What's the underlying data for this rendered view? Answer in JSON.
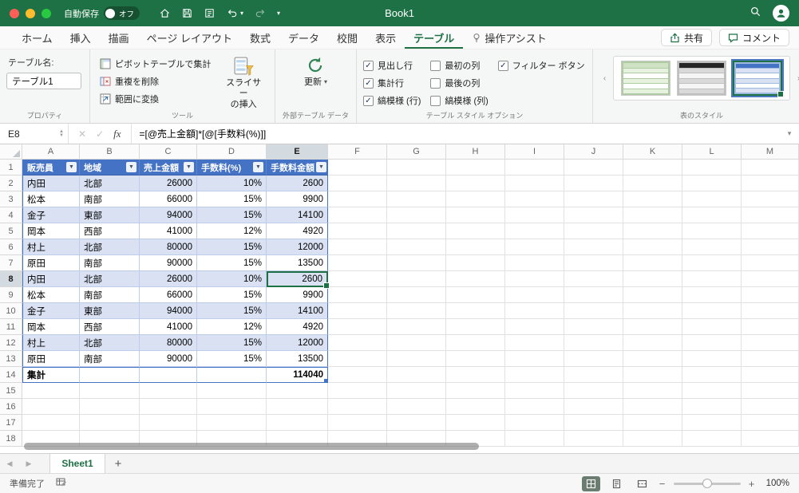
{
  "colors": {
    "titlebar_green": "#1E7145",
    "accent_green": "#217346",
    "table_header_blue": "#4472C4",
    "band_blue": "#D9E1F2"
  },
  "title_bar": {
    "autosave_label": "自動保存",
    "autosave_state": "オフ",
    "title": "Book1"
  },
  "menu_tabs": {
    "items": [
      {
        "label": "ホーム",
        "active": false
      },
      {
        "label": "挿入",
        "active": false
      },
      {
        "label": "描画",
        "active": false
      },
      {
        "label": "ページ レイアウト",
        "active": false
      },
      {
        "label": "数式",
        "active": false
      },
      {
        "label": "データ",
        "active": false
      },
      {
        "label": "校閲",
        "active": false
      },
      {
        "label": "表示",
        "active": false
      },
      {
        "label": "テーブル",
        "active": true
      },
      {
        "label": "操作アシスト",
        "active": false,
        "icon": "lightbulb"
      }
    ],
    "share_label": "共有",
    "comments_label": "コメント"
  },
  "ribbon": {
    "table_name": {
      "label": "テーブル名:",
      "value": "テーブル1",
      "group": "プロパティ"
    },
    "tools": {
      "buttons": [
        "ピボットテーブルで集計",
        "重複を削除",
        "範囲に変換"
      ],
      "slicer_line1": "スライサー",
      "slicer_line2": "の挿入",
      "group": "ツール"
    },
    "external": {
      "refresh_label": "更新",
      "group": "外部テーブル データ"
    },
    "options": {
      "checkboxes": [
        {
          "label": "見出し行",
          "checked": true
        },
        {
          "label": "集計行",
          "checked": true
        },
        {
          "label": "縞模様 (行)",
          "checked": true
        },
        {
          "label": "最初の列",
          "checked": false
        },
        {
          "label": "最後の列",
          "checked": false
        },
        {
          "label": "縞模様 (列)",
          "checked": false
        },
        {
          "label": "フィルター ボタン",
          "checked": true
        }
      ],
      "group": "テーブル スタイル オプション"
    },
    "styles": {
      "swatches": [
        "table-style-light-green",
        "table-style-dark",
        "table-style-blue"
      ],
      "selected_index": 2,
      "group": "表のスタイル"
    }
  },
  "formula_bar": {
    "name_box": "E8",
    "fx": "fx",
    "formula": "=[@売上金額]*[@[手数料(%)]]"
  },
  "grid": {
    "columns": [
      "A",
      "B",
      "C",
      "D",
      "E",
      "F",
      "G",
      "H",
      "I",
      "J",
      "K",
      "L",
      "M"
    ],
    "row_count": 18,
    "selected": {
      "col": "E",
      "row": 8
    },
    "table": {
      "headers": [
        "販売員",
        "地域",
        "売上金額",
        "手数料(%)",
        "手数料金額"
      ],
      "rows": [
        [
          "内田",
          "北部",
          "26000",
          "10%",
          "2600"
        ],
        [
          "松本",
          "南部",
          "66000",
          "15%",
          "9900"
        ],
        [
          "金子",
          "東部",
          "94000",
          "15%",
          "14100"
        ],
        [
          "岡本",
          "西部",
          "41000",
          "12%",
          "4920"
        ],
        [
          "村上",
          "北部",
          "80000",
          "15%",
          "12000"
        ],
        [
          "原田",
          "南部",
          "90000",
          "15%",
          "13500"
        ],
        [
          "内田",
          "北部",
          "26000",
          "10%",
          "2600"
        ],
        [
          "松本",
          "南部",
          "66000",
          "15%",
          "9900"
        ],
        [
          "金子",
          "東部",
          "94000",
          "15%",
          "14100"
        ],
        [
          "岡本",
          "西部",
          "41000",
          "12%",
          "4920"
        ],
        [
          "村上",
          "北部",
          "80000",
          "15%",
          "12000"
        ],
        [
          "原田",
          "南部",
          "90000",
          "15%",
          "13500"
        ]
      ],
      "total_label": "集計",
      "total_value": "114040"
    }
  },
  "sheet_bar": {
    "tabs": [
      {
        "label": "Sheet1",
        "active": true
      }
    ]
  },
  "status_bar": {
    "ready": "準備完了",
    "zoom": "100%"
  },
  "icons": {
    "filter_glyph": "▼",
    "check_glyph": "✓",
    "prev_glyph": "◀",
    "next_glyph": "▶",
    "gallery_prev_glyph": "‹",
    "gallery_next_glyph": "›",
    "add_sheet_glyph": "+",
    "minus_glyph": "−",
    "plus_glyph": "+",
    "caret_down_glyph": "▼"
  }
}
